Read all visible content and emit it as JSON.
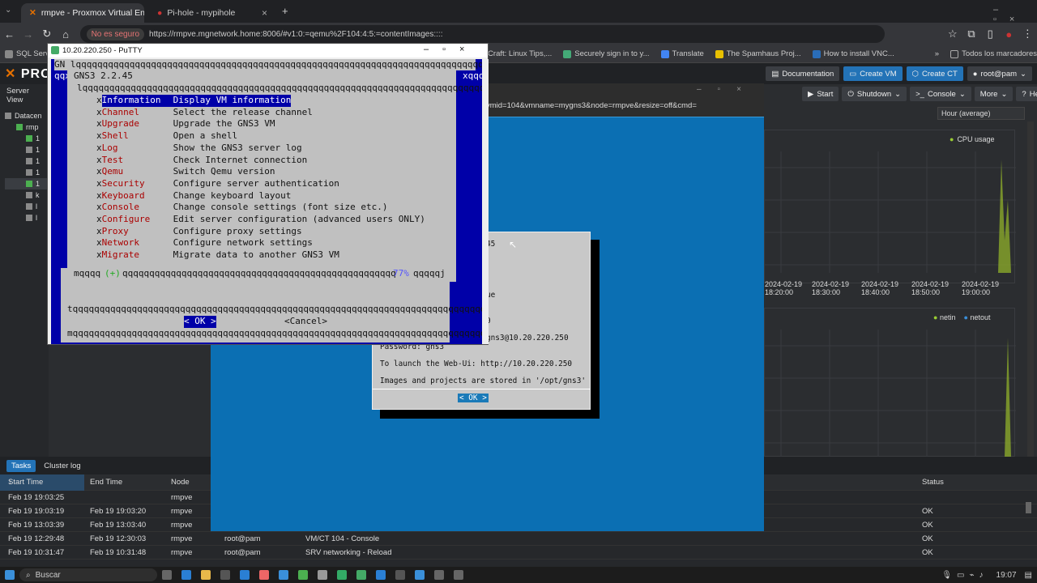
{
  "browser": {
    "tabs": [
      {
        "title": "rmpve - Proxmox Virtual Enviro",
        "icon": "proxmox-icon"
      },
      {
        "title": "Pi-hole - mypihole",
        "icon": "pihole-icon"
      }
    ],
    "security_label": "No es seguro",
    "url": "https://rmpve.mgnetwork.home:8006/#v1:0:=qemu%2F104:4:5:=contentImages::::",
    "bookmarks": [
      "SQL Serve",
      "nixCraft: Linux Tips,...",
      "Securely sign in to y...",
      "Translate",
      "The Spamhaus Proj...",
      "How to install VNC..."
    ],
    "bookmarks_all": "Todos los marcadores"
  },
  "pve": {
    "header_buttons": {
      "documentation": "Documentation",
      "create_vm": "Create VM",
      "create_ct": "Create CT",
      "user": "root@pam"
    },
    "server_view": "Server View",
    "tree": [
      "Datacen",
      "rmp",
      "1",
      "1",
      "1",
      "1",
      "1",
      "k",
      "l",
      "l"
    ],
    "toolbar": {
      "start": "Start",
      "shutdown": "Shutdown",
      "console": "Console",
      "more": "More",
      "help": "Help"
    },
    "timeframe": "Hour (average)",
    "cpu_legend": "CPU usage",
    "net_legend": {
      "in": "netin",
      "out": "netout"
    },
    "x_labels": [
      [
        "2024-02-19",
        "18:20:00"
      ],
      [
        "2024-02-19",
        "18:30:00"
      ],
      [
        "2024-02-19",
        "18:40:00"
      ],
      [
        "2024-02-19",
        "18:50:00"
      ],
      [
        "2024-02-19",
        "19:00:00"
      ]
    ],
    "tasks_tabs": {
      "tasks": "Tasks",
      "cluster_log": "Cluster log"
    },
    "tasks_columns": {
      "start": "Start Time",
      "end": "End Time",
      "node": "Node",
      "status": "Status"
    },
    "tasks": [
      {
        "start": "Feb 19 19:03:25",
        "end": "",
        "node": "rmpve",
        "user": "",
        "desc": "",
        "status": ""
      },
      {
        "start": "Feb 19 19:03:19",
        "end": "Feb 19 19:03:20",
        "node": "rmpve",
        "user": "",
        "desc": "",
        "status": "OK"
      },
      {
        "start": "Feb 19 13:03:39",
        "end": "Feb 19 13:03:40",
        "node": "rmpve",
        "user": "",
        "desc": "",
        "status": "OK"
      },
      {
        "start": "Feb 19 12:29:48",
        "end": "Feb 19 12:30:03",
        "node": "rmpve",
        "user": "root@pam",
        "desc": "VM/CT 104 - Console",
        "status": "OK"
      },
      {
        "start": "Feb 19 10:31:47",
        "end": "Feb 19 10:31:48",
        "node": "rmpve",
        "user": "root@pam",
        "desc": "SRV networking - Reload",
        "status": "OK"
      }
    ]
  },
  "console": {
    "url_fragment": "vmid=104&vmname=mygns3&node=rmpve&resize=off&cmd=",
    "dialog_lines": [
      "45",
      "ue",
      "0",
      "gns3@10.20.220.250",
      "Password: gns3",
      "To launch the Web-Ui: http://10.20.220.250",
      "Images and projects are stored in '/opt/gns3'"
    ],
    "ok": "<  OK  >"
  },
  "putty": {
    "title": "10.20.220.250 - PuTTY",
    "header": "GNS3 2.2.45",
    "menu": [
      {
        "tag": "Information",
        "desc": "Display VM information"
      },
      {
        "tag": "Channel",
        "desc": "Select the release channel"
      },
      {
        "tag": "Upgrade",
        "desc": "Upgrade the GNS3 VM"
      },
      {
        "tag": "Shell",
        "desc": "Open a shell"
      },
      {
        "tag": "Log",
        "desc": "Show the GNS3 server log"
      },
      {
        "tag": "Test",
        "desc": "Check Internet connection"
      },
      {
        "tag": "Qemu",
        "desc": "Switch Qemu version"
      },
      {
        "tag": "Security",
        "desc": "Configure server authentication"
      },
      {
        "tag": "Keyboard",
        "desc": "Change keyboard layout"
      },
      {
        "tag": "Console",
        "desc": "Change console settings (font size etc.)"
      },
      {
        "tag": "Configure",
        "desc": "Edit server configuration (advanced users ONLY)"
      },
      {
        "tag": "Proxy",
        "desc": "Configure proxy settings"
      },
      {
        "tag": "Network",
        "desc": "Configure network settings"
      },
      {
        "tag": "Migrate",
        "desc": "Migrate data to another GNS3 VM"
      }
    ],
    "more": "(+)",
    "percent": "77%",
    "ok": "< OK >",
    "cancel": "<Cancel>"
  },
  "taskbar": {
    "search": "Buscar",
    "time": "19:07"
  }
}
